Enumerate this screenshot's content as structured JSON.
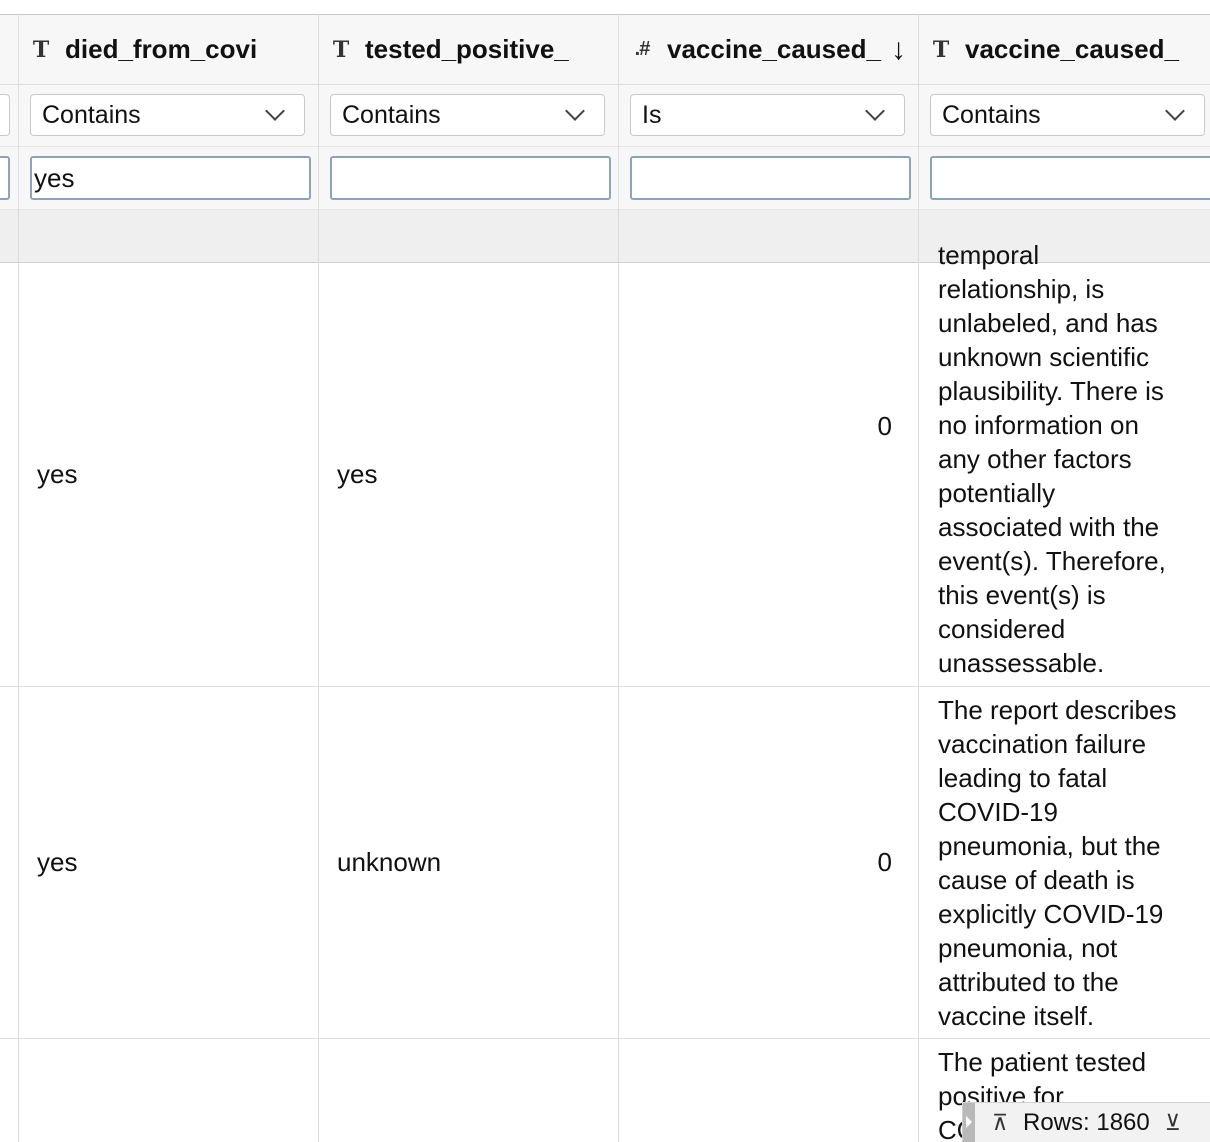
{
  "columns": [
    {
      "title": "died_from_covi",
      "type_icon": "T",
      "filter_op": "Contains",
      "filter_value": "yes"
    },
    {
      "title": "tested_positive_",
      "type_icon": "T",
      "filter_op": "Contains",
      "filter_value": ""
    },
    {
      "title": "vaccine_caused_",
      "type_icon": ".#",
      "filter_op": "Is",
      "filter_value": "",
      "sort_icon": "↓"
    },
    {
      "title": "vaccine_caused_",
      "type_icon": "T",
      "filter_op": "Contains",
      "filter_value": ""
    }
  ],
  "rows": [
    {
      "died_from_covid": "yes",
      "tested_positive": "yes",
      "vaccine_caused_num": "0",
      "vaccine_caused_text": "temporal\nrelationship, is\nunlabeled, and has\nunknown scientific\nplausibility. There is\nno information on\nany other factors\npotentially\nassociated with the\nevent(s). Therefore,\nthis event(s) is\nconsidered\nunassessable."
    },
    {
      "died_from_covid": "yes",
      "tested_positive": "unknown",
      "vaccine_caused_num": "0",
      "vaccine_caused_text": "The report describes\nvaccination failure\nleading to fatal\nCOVID-19\npneumonia, but the\ncause of death is\nexplicitly COVID-19\npneumonia, not\nattributed to the\nvaccine itself."
    },
    {
      "vaccine_caused_text": "The patient tested\npositive for\nCO"
    }
  ],
  "status": {
    "rows_label": "Rows: 1860",
    "scroll_top_icon": "⊼",
    "scroll_bottom_icon": "⊻"
  }
}
